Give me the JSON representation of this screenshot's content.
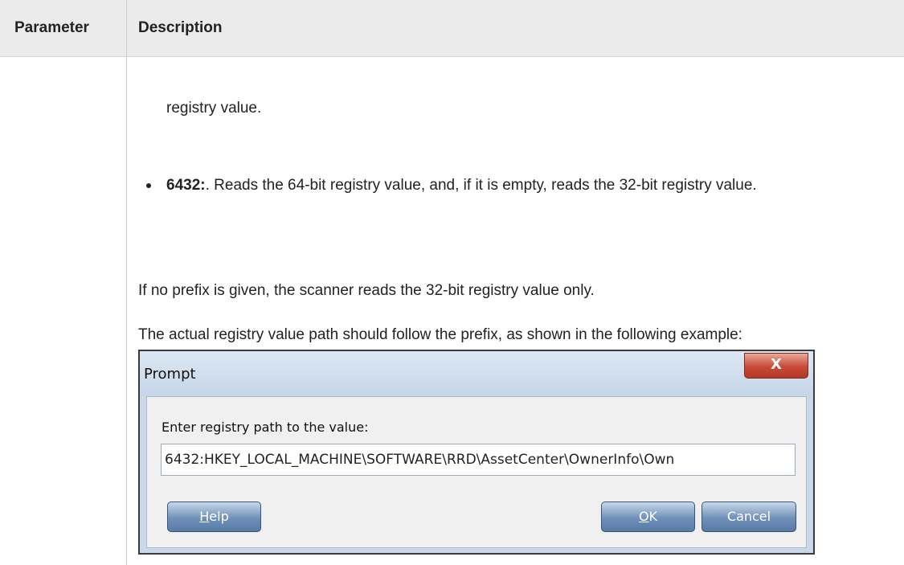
{
  "table": {
    "headers": {
      "parameter": "Parameter",
      "description": "Description"
    }
  },
  "description": {
    "continued_text": "registry value.",
    "bullet": {
      "prefix": "6432:",
      "text": ". Reads the 64-bit registry value, and, if it is empty, reads the 32-bit registry value."
    },
    "paragraph1": "If no prefix is given, the scanner reads the 32-bit registry value only.",
    "paragraph2": "The actual registry value path should follow the prefix, as shown in the following example:"
  },
  "dialog": {
    "title": "Prompt",
    "close_glyph": "X",
    "label": "Enter registry path to the value:",
    "input_value": "6432:HKEY_LOCAL_MACHINE\\SOFTWARE\\RRD\\AssetCenter\\OwnerInfo\\Own",
    "help_button": {
      "accel": "H",
      "rest": "elp"
    },
    "ok_button": {
      "accel": "O",
      "rest": "K"
    },
    "cancel_button": "Cancel"
  }
}
